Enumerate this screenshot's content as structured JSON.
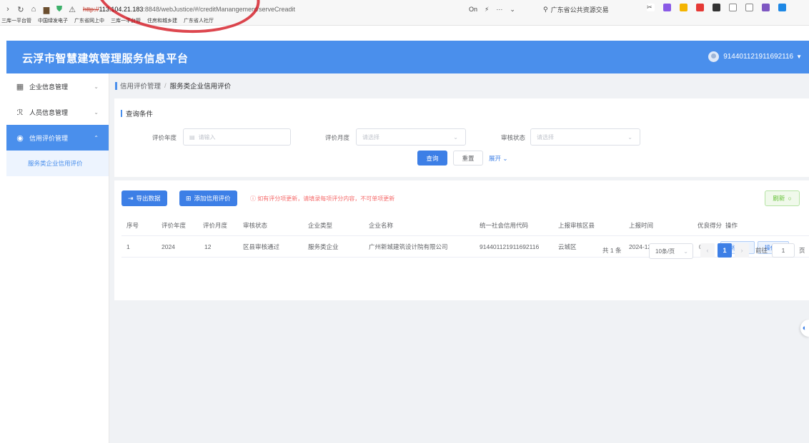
{
  "browser": {
    "url_protocol": "http://",
    "url_host": "113.104.21.183",
    "url_rest": ":8848/webJustice/#/creditManangement/serveCreadit",
    "search_text": "广东省公共资源交易",
    "bookmarks": [
      "三库一平台管",
      "中国绿发电子",
      "广东省网上中",
      "三库一平台管",
      "住房和城乡建",
      "广东省人社厅"
    ]
  },
  "app": {
    "title": "云浮市智慧建筑管理服务信息平台",
    "user": "914401121911692116"
  },
  "sidebar": {
    "items": [
      {
        "label": "企业信息管理",
        "icon": "building-icon"
      },
      {
        "label": "人员信息管理",
        "icon": "users-icon"
      },
      {
        "label": "信用评价管理",
        "icon": "shield-icon"
      }
    ],
    "submenu": [
      "服务类企业信用评价"
    ]
  },
  "breadcrumb": {
    "parent": "信用评价管理",
    "separator": "/",
    "current": "服务类企业信用评价"
  },
  "query": {
    "title": "查询条件",
    "year_label": "评价年度",
    "year_placeholder": "请输入",
    "month_label": "评价月度",
    "month_placeholder": "请选择",
    "status_label": "审核状态",
    "status_placeholder": "请选择",
    "search_label": "查询",
    "reset_label": "重置",
    "expand_label": "展开"
  },
  "toolbar": {
    "export_label": "导出数据",
    "add_label": "添加信用评价",
    "notice": "如有评分项更新，请填录每项评分内容，不可单项更新",
    "refresh_label": "刷新"
  },
  "table": {
    "headers": [
      "序号",
      "评价年度",
      "评价月度",
      "审核状态",
      "企业类型",
      "企业名称",
      "统一社会信用代码",
      "上报审核区县",
      "上报时间",
      "优良得分",
      "操作"
    ],
    "rows": [
      [
        "1",
        "2024",
        "12",
        "区县审核通过",
        "服务类企业",
        "广州新城建筑设计院有限公司",
        "914401121911692116",
        "云城区",
        "2024-12-17 10:...",
        "0"
      ]
    ],
    "row_actions": {
      "record": "审核记录",
      "ops": "操作"
    }
  },
  "pagination": {
    "total": "共 1 条",
    "page_size": "10条/页",
    "current_page": "1",
    "goto_label": "前往",
    "goto_value": "1",
    "page_suffix": "页"
  },
  "colors": {
    "primary": "#4a8fec",
    "danger": "#f56c6c",
    "success": "#67c23a"
  }
}
